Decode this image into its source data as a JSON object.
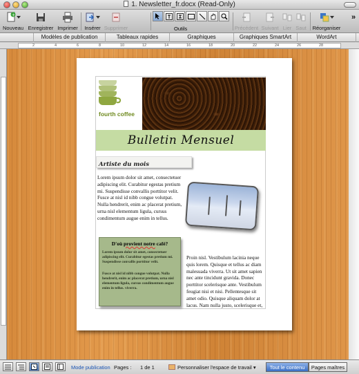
{
  "window": {
    "title": "1. Newsletter_fr.docx (Read-Only)"
  },
  "toolbar": {
    "nouveau": "Nouveau",
    "enregistrer": "Enregistrer",
    "imprimer": "Imprimer",
    "inserer": "Insérer",
    "supprimer": "Supprimer",
    "outils": "Outils",
    "precedent": "Précédent",
    "suivant": "Suivant",
    "lier": "Lier",
    "saut": "Saut",
    "reorganiser": "Réorganiser"
  },
  "gallery_tabs": [
    "Modèles de publication",
    "Tableaux rapides",
    "Graphiques",
    "Graphiques SmartArt",
    "WordArt"
  ],
  "ruler_numbers": [
    "2",
    "4",
    "6",
    "8",
    "10",
    "12",
    "14",
    "16",
    "18",
    "20",
    "22",
    "24",
    "26",
    "28"
  ],
  "document": {
    "logo_text": "fourth coffee",
    "banner": "Bulletin Mensuel",
    "artist_heading": "Artiste du mois",
    "body1": "Lorem ipsum dolor sit amet, consectetuer adipiscing elit. Curabitur egestas pretium mi. Suspendisse convallis porttitor velit. Fusce at nisl id nibb congue volutpat. Nulla hendrerit, enim ac placerat pretium, urna nisl elementum ligula, cursus condimentum augue enim in tellus.",
    "sidebar_heading_pre": "D'où ",
    "sidebar_heading_underlined": "provient notre",
    "sidebar_heading_post": " café?",
    "sidebar_p1": "Lorem ipsum dolor sit amet, consectetuer adipiscing elit. Curabitur egestas pretium mi. Suspendisse convallis porttitor velit.",
    "sidebar_p2": "Fusce at nisl id nibb congue volutpat. Nulla hendrerit, enim ac placerat pretium, urna nisl elementum ligula, cursus condimentum augue enim in tellus. viverra.",
    "body2": "Proin nisl. Vestibulum lacinia neque quis lorem. Quisque et tellus ac diam malesuada viverra. Ut sit amet sapien nec ante tincidunt gravida. Donec porttitor scelerisque ante. Vestibulum feugiat nisi et nisi. Pellentesque sit amet odio. Quisque aliquam dolor at lacus. Nam nulla justo, scelerisque et,"
  },
  "status": {
    "mode": "Mode publication",
    "pages_label": "Pages :",
    "pages_value": "1 de 1",
    "workspace": "Personnaliser l'espace de travail",
    "tout_contenu": "Tout le contenu",
    "pages_maitres": "Pages maîtres"
  }
}
